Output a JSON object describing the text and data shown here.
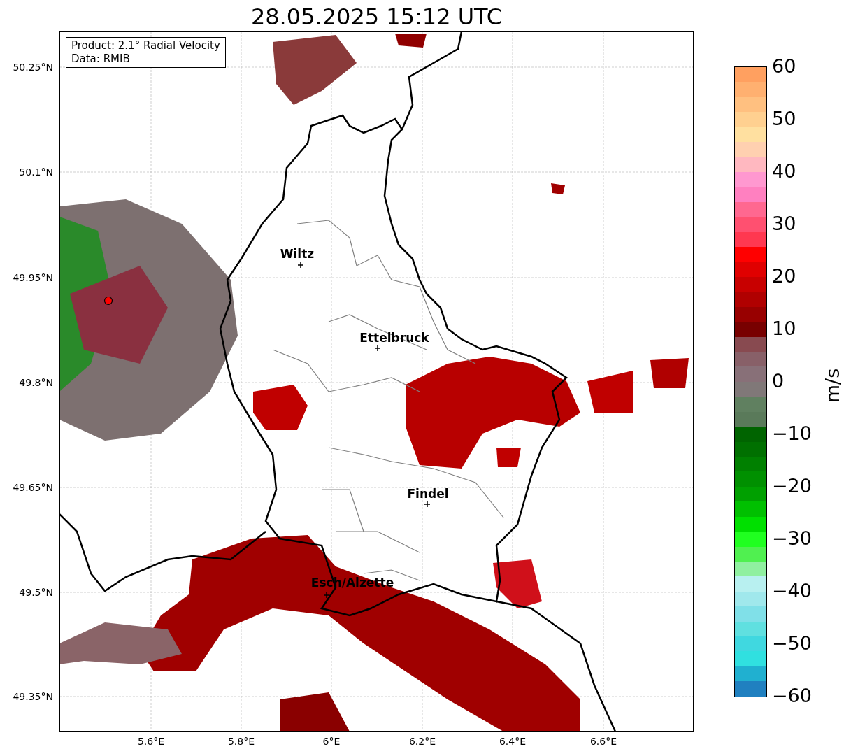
{
  "title": "28.05.2025 15:12 UTC",
  "info_box": {
    "product": "Product: 2.1° Radial Velocity",
    "data": "Data: RMIB"
  },
  "y_ticks": [
    "50.25°N",
    "50.1°N",
    "49.95°N",
    "49.8°N",
    "49.65°N",
    "49.5°N",
    "49.35°N"
  ],
  "x_ticks": [
    "5.6°E",
    "5.8°E",
    "6°E",
    "6.2°E",
    "6.4°E",
    "6.6°E"
  ],
  "cities": [
    {
      "name": "Wiltz"
    },
    {
      "name": "Ettelbruck"
    },
    {
      "name": "Findel"
    },
    {
      "name": "Esch/Alzette"
    }
  ],
  "colorbar": {
    "label": "m/s",
    "ticks": [
      "60",
      "50",
      "40",
      "30",
      "20",
      "10",
      "0",
      "−10",
      "−20",
      "−30",
      "−40",
      "−50",
      "−60"
    ]
  }
}
